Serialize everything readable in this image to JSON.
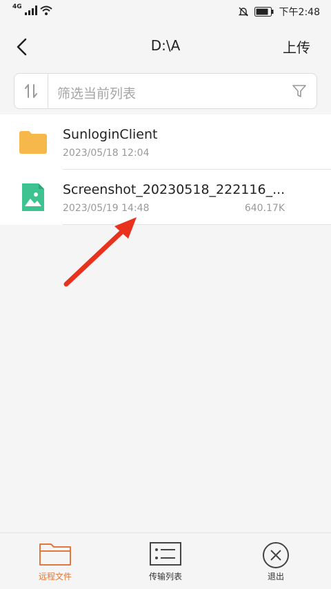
{
  "status_bar": {
    "network": "4G",
    "time": "下午2:48"
  },
  "header": {
    "title": "D:\\A",
    "upload_label": "上传"
  },
  "filter": {
    "placeholder": "筛选当前列表"
  },
  "files": [
    {
      "name": "SunloginClient",
      "date": "2023/05/18 12:04",
      "size": "",
      "type": "folder"
    },
    {
      "name": "Screenshot_20230518_222116_...",
      "date": "2023/05/19 14:48",
      "size": "640.17K",
      "type": "image"
    }
  ],
  "bottom_nav": [
    {
      "label": "远程文件",
      "icon": "folder-icon",
      "active": true
    },
    {
      "label": "传输列表",
      "icon": "list-icon",
      "active": false
    },
    {
      "label": "退出",
      "icon": "exit-icon",
      "active": false
    }
  ],
  "colors": {
    "accent": "#e1783e",
    "folder": "#f6b84a",
    "image_file": "#3cc38f",
    "annotation_arrow": "#e8321e"
  }
}
